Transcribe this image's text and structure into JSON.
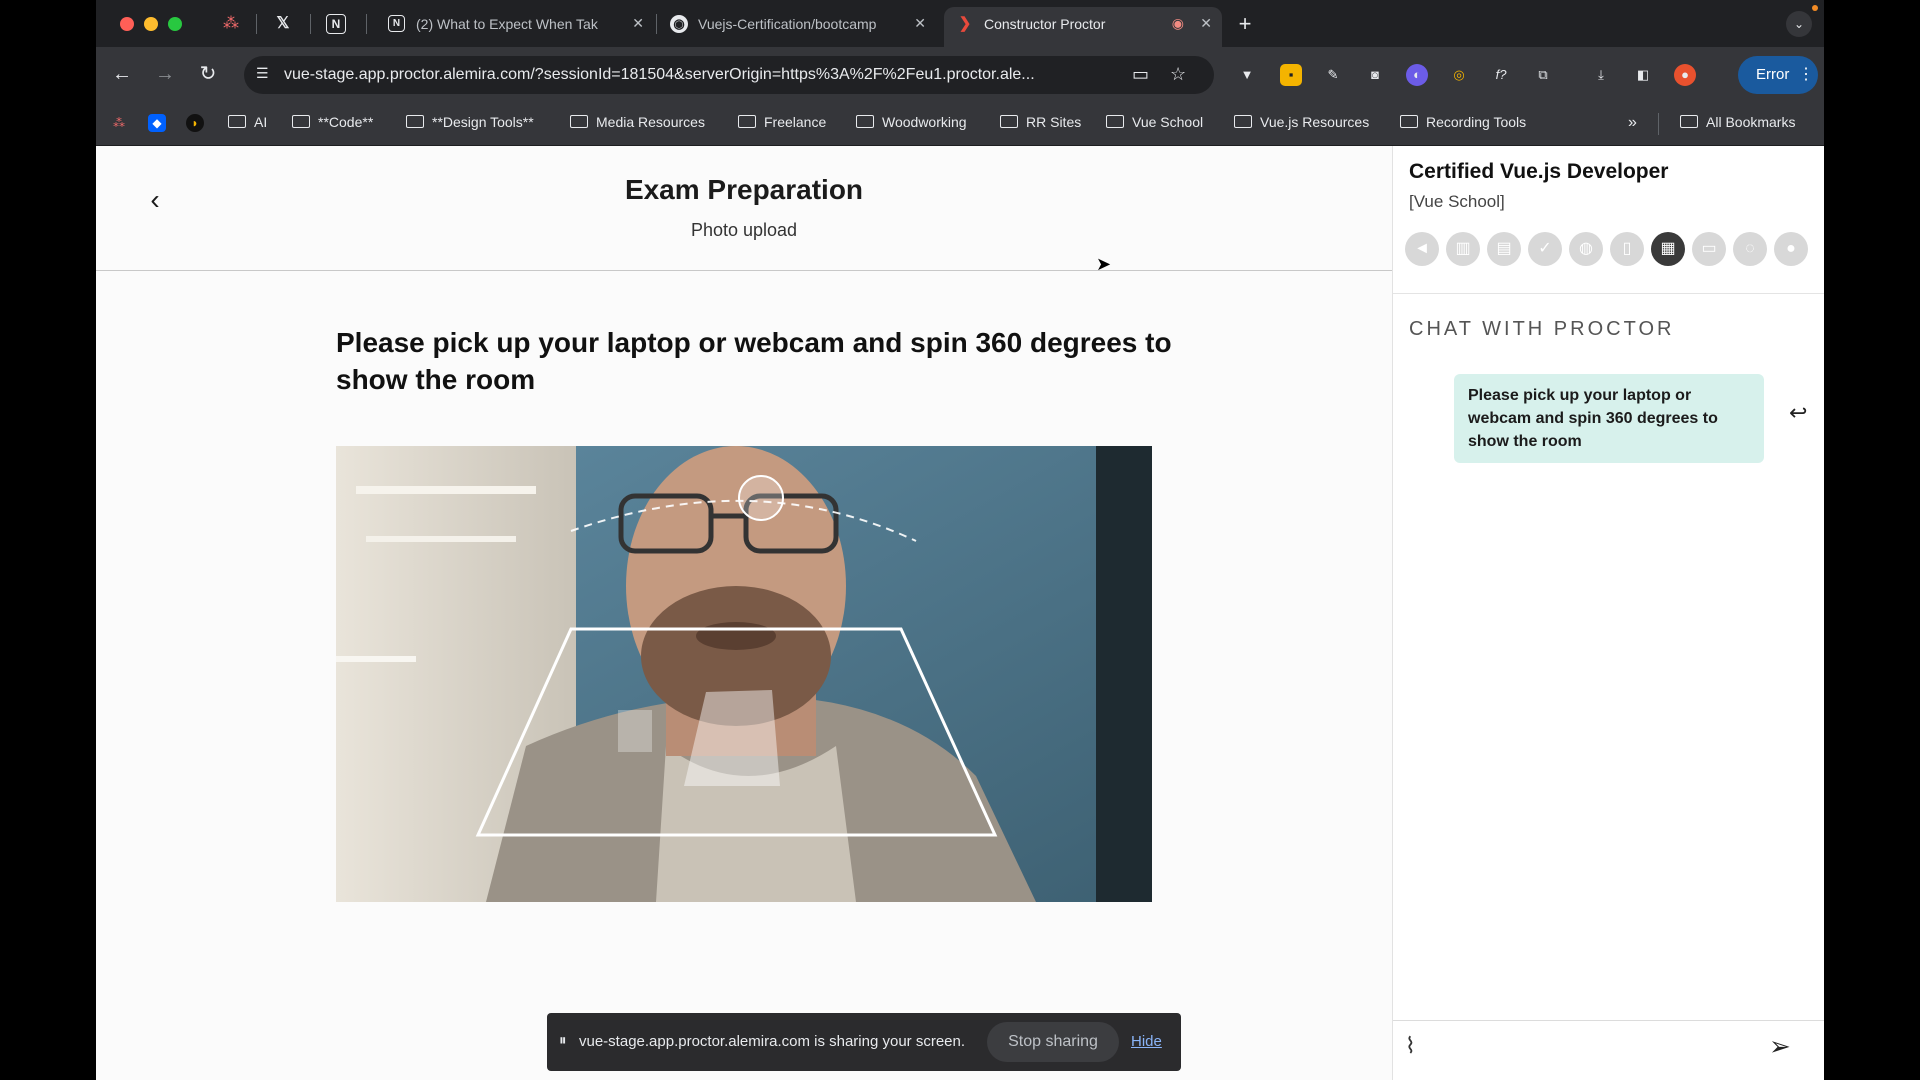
{
  "tabs": [
    {
      "title": "(2) What to Expect When Tak",
      "icon": "notion-icon"
    },
    {
      "title": "Vuejs-Certification/bootcamp",
      "icon": "github-icon"
    },
    {
      "title": "Constructor Proctor",
      "icon": "constructor-icon",
      "active": true
    }
  ],
  "toolbar": {
    "url": "vue-stage.app.proctor.alemira.com/?sessionId=181504&serverOrigin=https%3A%2F%2Feu1.proctor.ale...",
    "error_label": "Error"
  },
  "bookmarks": [
    "AI",
    "**Code**",
    "**Design Tools**",
    "Media Resources",
    "Freelance",
    "Woodworking",
    "RR Sites",
    "Vue School",
    "Vue.js Resources",
    "Recording Tools"
  ],
  "all_bookmarks": "All Bookmarks",
  "header": {
    "title": "Exam Preparation",
    "subtitle": "Photo upload"
  },
  "instruction": "Please pick up your laptop or webcam and spin 360 degrees to show the room",
  "panel": {
    "course_title": "Certified Vue.js Developer",
    "course_org": "[Vue School]",
    "chat_label": "CHAT WITH PROCTOR",
    "chat_messages": [
      {
        "text": "Please pick up your laptop or webcam and spin 360 degrees to show the room"
      }
    ]
  },
  "share_bar": {
    "message": "vue-stage.app.proctor.alemira.com is sharing your screen.",
    "stop_label": "Stop sharing",
    "hide_label": "Hide"
  }
}
